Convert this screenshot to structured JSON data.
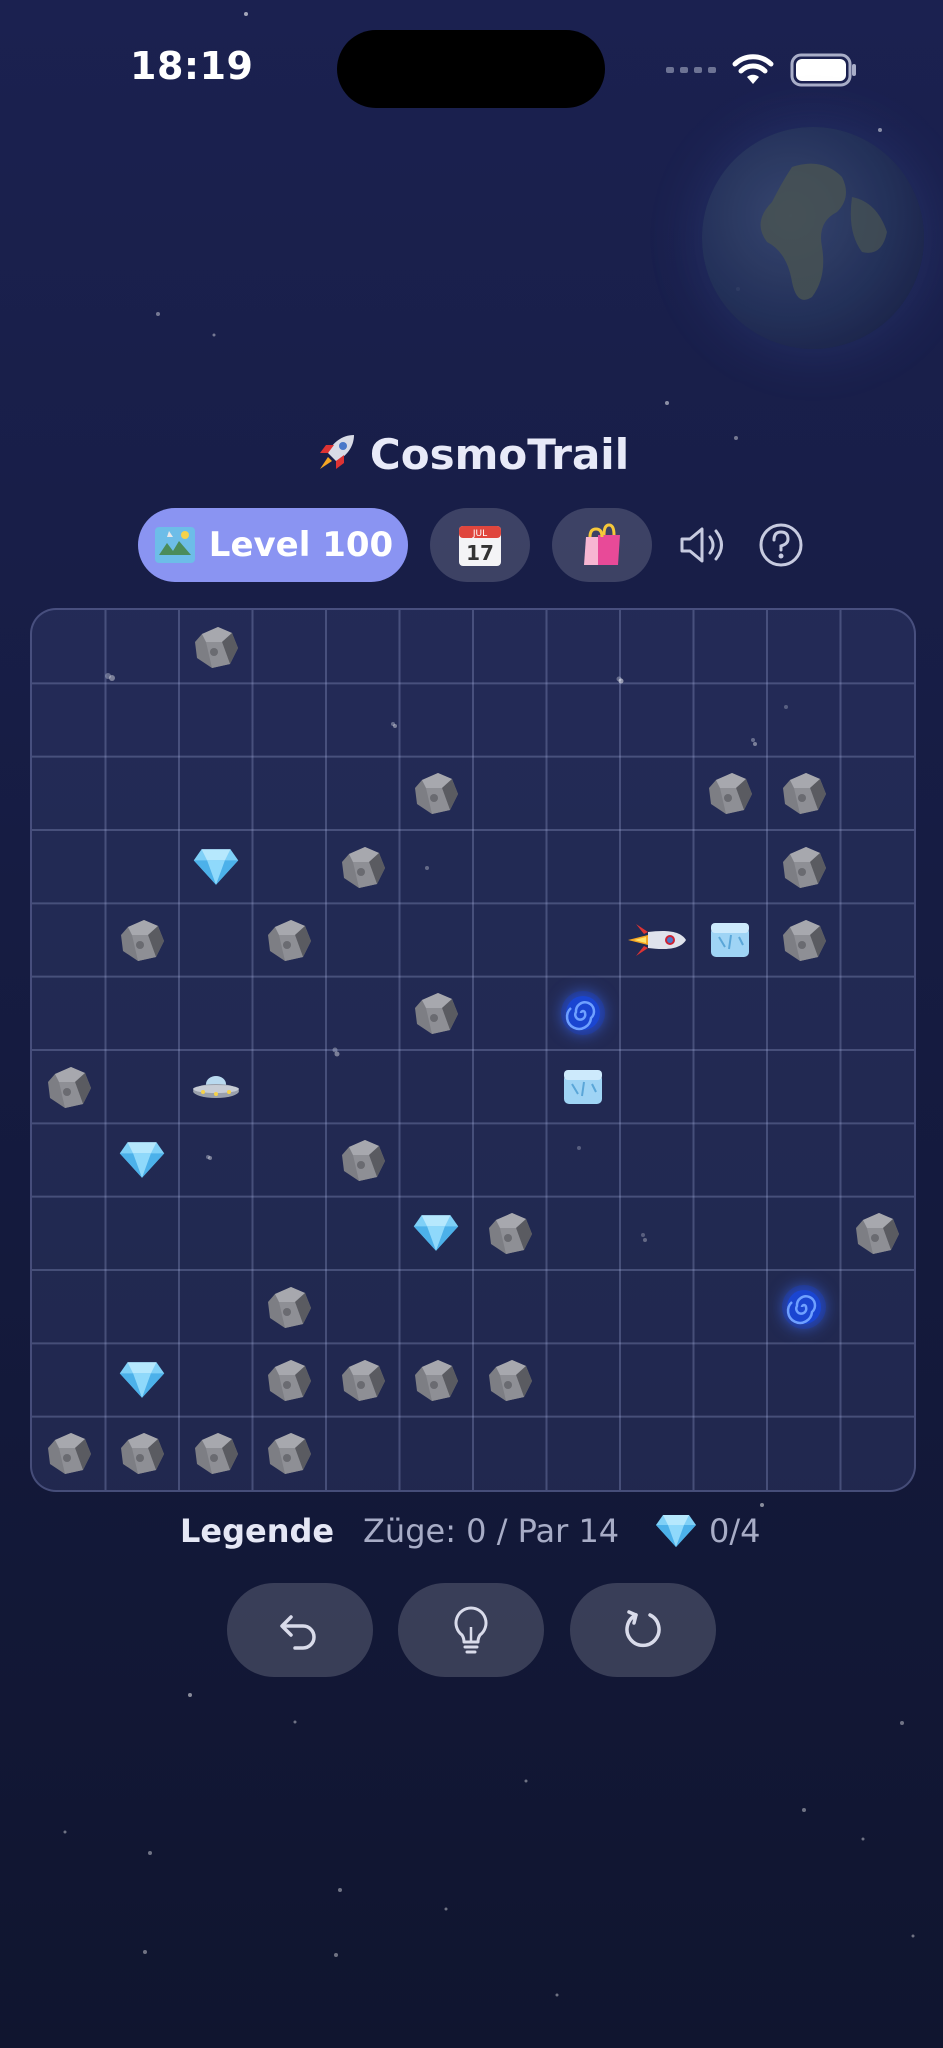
{
  "status_bar": {
    "time": "18:19"
  },
  "header": {
    "app_title": "CosmoTrail"
  },
  "toolbar": {
    "level_label": "Level 100",
    "calendar_day": "17",
    "calendar_month": "JUL"
  },
  "board": {
    "columns": 12,
    "rows": 12,
    "cells": [
      {
        "row": 0,
        "col": 2,
        "type": "asteroid"
      },
      {
        "row": 2,
        "col": 5,
        "type": "asteroid"
      },
      {
        "row": 2,
        "col": 9,
        "type": "asteroid"
      },
      {
        "row": 2,
        "col": 10,
        "type": "asteroid"
      },
      {
        "row": 3,
        "col": 2,
        "type": "gem"
      },
      {
        "row": 3,
        "col": 4,
        "type": "asteroid"
      },
      {
        "row": 3,
        "col": 10,
        "type": "asteroid"
      },
      {
        "row": 4,
        "col": 1,
        "type": "asteroid"
      },
      {
        "row": 4,
        "col": 3,
        "type": "asteroid"
      },
      {
        "row": 4,
        "col": 8,
        "type": "rocket"
      },
      {
        "row": 4,
        "col": 9,
        "type": "ice"
      },
      {
        "row": 4,
        "col": 10,
        "type": "asteroid"
      },
      {
        "row": 5,
        "col": 5,
        "type": "asteroid"
      },
      {
        "row": 5,
        "col": 7,
        "type": "wormhole"
      },
      {
        "row": 6,
        "col": 0,
        "type": "asteroid"
      },
      {
        "row": 6,
        "col": 2,
        "type": "ufo"
      },
      {
        "row": 6,
        "col": 7,
        "type": "ice"
      },
      {
        "row": 7,
        "col": 1,
        "type": "gem"
      },
      {
        "row": 7,
        "col": 4,
        "type": "asteroid"
      },
      {
        "row": 8,
        "col": 5,
        "type": "gem"
      },
      {
        "row": 8,
        "col": 6,
        "type": "asteroid"
      },
      {
        "row": 8,
        "col": 11,
        "type": "asteroid"
      },
      {
        "row": 9,
        "col": 3,
        "type": "asteroid"
      },
      {
        "row": 9,
        "col": 10,
        "type": "wormhole"
      },
      {
        "row": 10,
        "col": 1,
        "type": "gem"
      },
      {
        "row": 10,
        "col": 3,
        "type": "asteroid"
      },
      {
        "row": 10,
        "col": 4,
        "type": "asteroid"
      },
      {
        "row": 10,
        "col": 5,
        "type": "asteroid"
      },
      {
        "row": 10,
        "col": 6,
        "type": "asteroid"
      },
      {
        "row": 11,
        "col": 0,
        "type": "asteroid"
      },
      {
        "row": 11,
        "col": 1,
        "type": "asteroid"
      },
      {
        "row": 11,
        "col": 2,
        "type": "asteroid"
      },
      {
        "row": 11,
        "col": 3,
        "type": "asteroid"
      }
    ]
  },
  "stats": {
    "legend_label": "Legende",
    "moves_text": "Züge: 0 / Par 14",
    "gems_text": "0/4"
  },
  "icons": {
    "level": "map-icon",
    "calendar": "calendar-icon",
    "shop": "shopping-bags-icon",
    "sound": "speaker-icon",
    "help": "help-icon",
    "undo": "undo-icon",
    "hint": "lightbulb-icon",
    "restart": "restart-icon"
  },
  "colors": {
    "accent": "#8a94f2",
    "background_top": "#1b2150",
    "background_bottom": "#10152f"
  }
}
